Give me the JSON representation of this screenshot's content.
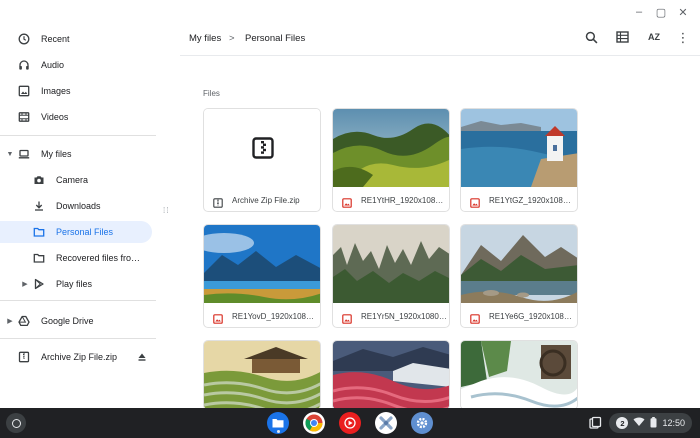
{
  "window_controls": {
    "minimize": "–",
    "restore": "▢",
    "close": "✕"
  },
  "sidebar": {
    "items": [
      {
        "label": "Recent",
        "icon": "clock-icon"
      },
      {
        "label": "Audio",
        "icon": "headphones-icon"
      },
      {
        "label": "Images",
        "icon": "image-icon"
      },
      {
        "label": "Videos",
        "icon": "film-icon"
      },
      {
        "label": "My files",
        "icon": "laptop-icon"
      },
      {
        "label": "Camera",
        "icon": "camera-folder-icon"
      },
      {
        "label": "Downloads",
        "icon": "download-icon"
      },
      {
        "label": "Personal Files",
        "icon": "folder-icon"
      },
      {
        "label": "Recovered files from ...",
        "icon": "folder-icon"
      },
      {
        "label": "Play files",
        "icon": "play-store-icon"
      },
      {
        "label": "Google Drive",
        "icon": "google-drive-icon"
      },
      {
        "label": "Archive Zip File.zip",
        "icon": "zip-icon"
      }
    ],
    "active": "Personal Files"
  },
  "breadcrumb": {
    "parent": "My files",
    "separator": ">",
    "current": "Personal Files"
  },
  "toolbar": {
    "search": "search-icon",
    "view": "list-view-icon",
    "sort": "AZ"
  },
  "content": {
    "section_label": "Files",
    "files": [
      {
        "name": "Archive Zip File.zip",
        "type": "zip"
      },
      {
        "name": "RE1YtHR_1920x1080.jpg",
        "type": "image"
      },
      {
        "name": "RE1YtGZ_1920x1080.jpg",
        "type": "image"
      },
      {
        "name": "RE1YovD_1920x1080.jpg",
        "type": "image"
      },
      {
        "name": "RE1Yr5N_1920x1080.jpg",
        "type": "image"
      },
      {
        "name": "RE1Ye6G_1920x1080.jpg",
        "type": "image"
      },
      {
        "name": "",
        "type": "image"
      },
      {
        "name": "",
        "type": "image"
      },
      {
        "name": "",
        "type": "image"
      }
    ]
  },
  "shelf": {
    "apps": [
      "files-app",
      "chrome",
      "youtube-music",
      "settings-app-2",
      "settings"
    ],
    "tray": {
      "notification_count": "2",
      "time": "12:50"
    }
  },
  "colors": {
    "accent": "#1a73e8",
    "active_bg": "#e8f0fe",
    "shelf": "#202124",
    "file_image_icon": "#d93025"
  }
}
